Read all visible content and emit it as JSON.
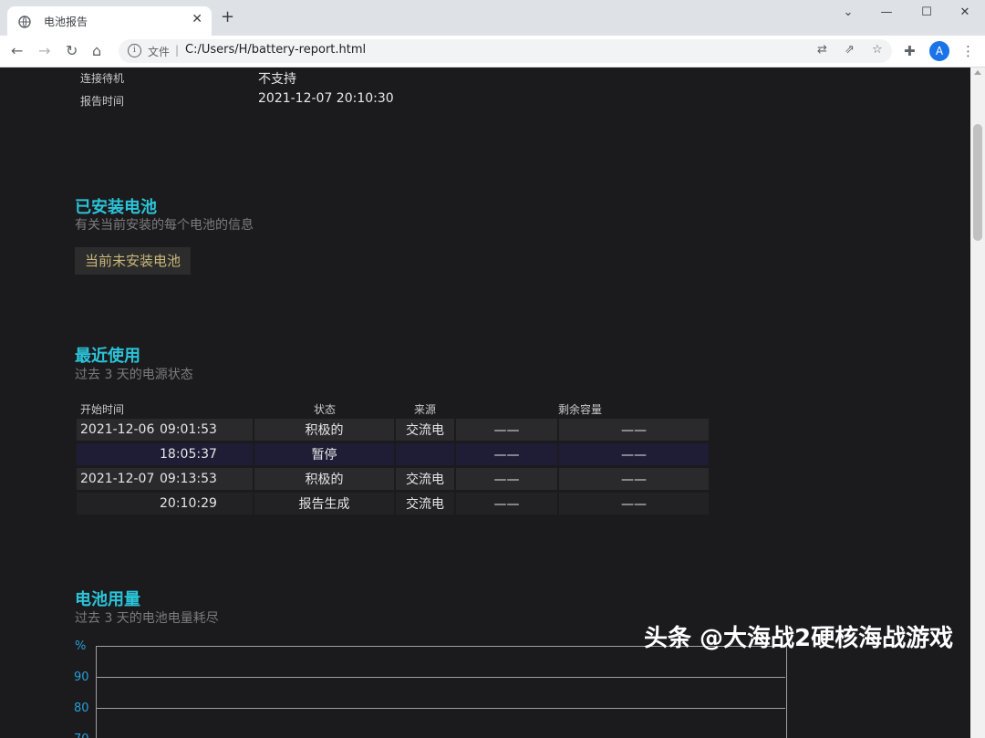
{
  "browser": {
    "tab_title": "电池报告",
    "scheme_label": "文件",
    "url": "C:/Users/H/battery-report.html",
    "avatar_letter": "A"
  },
  "report_info": [
    {
      "label": "连接待机",
      "value": "不支持"
    },
    {
      "label": "报告时间",
      "value": "2021-12-07  20:10:30"
    }
  ],
  "installed": {
    "title": "已安装电池",
    "subtitle": "有关当前安装的每个电池的信息",
    "notice": "当前未安装电池"
  },
  "recent": {
    "title": "最近使用",
    "subtitle": "过去 3 天的电源状态",
    "headers": [
      "开始时间",
      "状态",
      "来源",
      "剩余容量"
    ],
    "rows": [
      {
        "date": "2021-12-06",
        "time": "09:01:53",
        "state": "积极的",
        "source": "交流电",
        "cap1": "——",
        "cap2": "——"
      },
      {
        "date": "",
        "time": "18:05:37",
        "state": "暂停",
        "source": "",
        "cap1": "——",
        "cap2": "——"
      },
      {
        "date": "2021-12-07",
        "time": "09:13:53",
        "state": "积极的",
        "source": "交流电",
        "cap1": "——",
        "cap2": "——"
      },
      {
        "date": "",
        "time": "20:10:29",
        "state": "报告生成",
        "source": "交流电",
        "cap1": "——",
        "cap2": "——"
      }
    ]
  },
  "usage": {
    "title": "电池用量",
    "subtitle": "过去 3 天的电池电量耗尽",
    "y_unit": "%",
    "y_ticks": [
      "90",
      "80",
      "70"
    ]
  },
  "watermark": "头条 @大海战2硬核海战游戏",
  "colors": {
    "heading": "#2bc4d8",
    "background": "#1b1a1d",
    "notice_text": "#c9b87a",
    "axis": "#2a9fd6"
  }
}
